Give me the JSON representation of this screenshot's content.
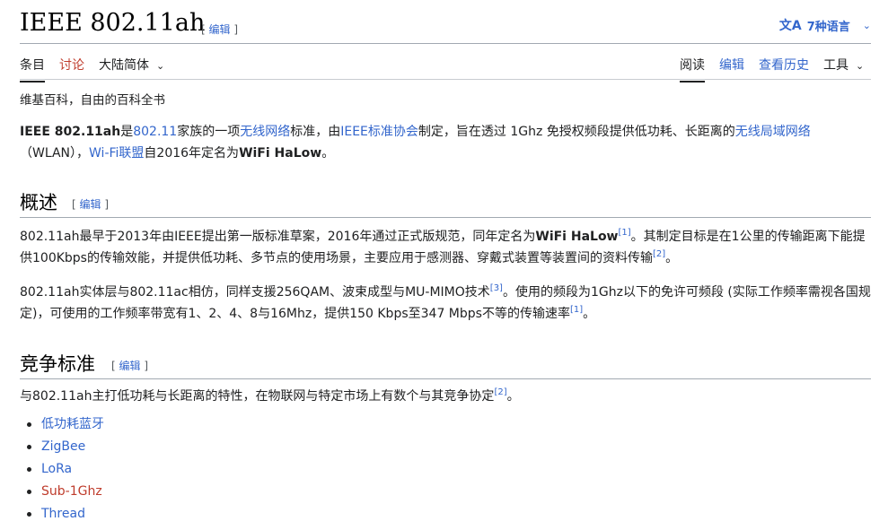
{
  "header": {
    "title": "IEEE 802.11ah",
    "edit": {
      "open": "[ ",
      "label": "编辑",
      "close": " ]"
    },
    "languages": {
      "icon": "文A",
      "label": "7种语言",
      "chevron": "⌄"
    }
  },
  "tabs": {
    "article": "条目",
    "talk": "讨论",
    "variant": "大陆简体",
    "read": "阅读",
    "edit": "编辑",
    "history": "查看历史",
    "tools": "工具",
    "chevron": "⌄"
  },
  "tagline": "维基百科，自由的百科全书",
  "intro": {
    "t1": "IEEE 802.11ah",
    "t2": "是",
    "l1": "802.11",
    "t3": "家族的一项",
    "l2": "无线网络",
    "t4": "标准，由",
    "l3": "IEEE标准协会",
    "t5": "制定，旨在透过 1Ghz 免授权频段提供低功耗、长距离的",
    "l4": "无线局域网络",
    "t6": "（WLAN），",
    "l5": "Wi-Fi联盟",
    "t7": "自2016年定名为",
    "t8": "WiFi HaLow",
    "t9": "。"
  },
  "overview": {
    "heading": "概述",
    "edit": {
      "open": "[ ",
      "label": "编辑",
      "close": " ]"
    },
    "p1": {
      "t1": "802.11ah最早于2013年由IEEE提出第一版标准草案，2016年通过正式版规范，同年定名为",
      "b1": "WiFi HaLow",
      "r1": "[1]",
      "t2": "。其制定目标是在1公里的传输距离下能提供100Kbps的传输效能，并提供低功耗、多节点的使用场景，主要应用于感测器、穿戴式装置等装置间的资料传输",
      "r2": "[2]",
      "t3": "。"
    },
    "p2": {
      "t1": "802.11ah实体层与802.11ac相仿，同样支援256QAM、波束成型与MU-MIMO技术",
      "r1": "[3]",
      "t2": "。使用的频段为1Ghz以下的免许可频段 (实际工作频率需视各国规定)，可使用的工作频率带宽有1、2、4、8与16Mhz，提供150 Kbps至347 Mbps不等的传输速率",
      "r2": "[1]",
      "t3": "。"
    }
  },
  "competing": {
    "heading": "竞争标准",
    "edit": {
      "open": "[ ",
      "label": "编辑",
      "close": " ]"
    },
    "p1": {
      "t1": "与802.11ah主打低功耗与长距离的特性，在物联网与特定市场上有数个与其竞争协定",
      "r1": "[2]",
      "t2": "。"
    },
    "items": [
      "低功耗蓝牙",
      "ZigBee",
      "LoRa",
      "Sub-1Ghz",
      "Thread"
    ]
  },
  "colors": {
    "link": "#3366cc",
    "redlink": "#bf3c2c",
    "text": "#202122"
  }
}
